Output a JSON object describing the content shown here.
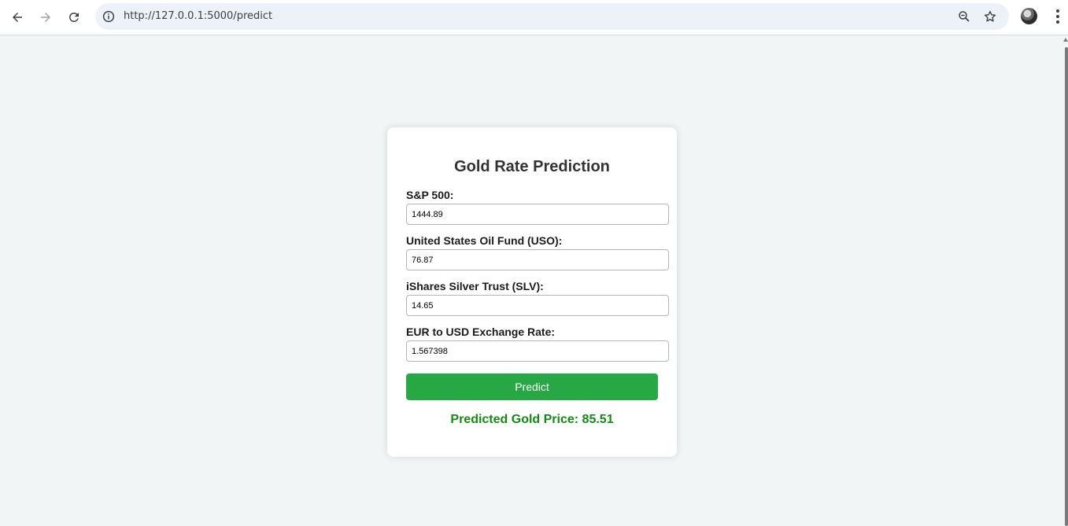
{
  "browser": {
    "url": "http://127.0.0.1:5000/predict",
    "icons": [
      "back-icon",
      "forward-icon",
      "reload-icon",
      "site-info-icon",
      "zoom-icon",
      "bookmark-star-icon",
      "profile-avatar",
      "menu-icon"
    ]
  },
  "form": {
    "title": "Gold Rate Prediction",
    "fields": [
      {
        "label": "S&P 500:",
        "value": "1444.89"
      },
      {
        "label": "United States Oil Fund (USO):",
        "value": "76.87"
      },
      {
        "label": "iShares Silver Trust (SLV):",
        "value": "14.65"
      },
      {
        "label": "EUR to USD Exchange Rate:",
        "value": "1.567398"
      }
    ],
    "button_label": "Predict",
    "result": "Predicted Gold Price: 85.51"
  },
  "colors": {
    "background": "#f2f5f6",
    "button": "#28a745",
    "result_text": "#138a13"
  }
}
